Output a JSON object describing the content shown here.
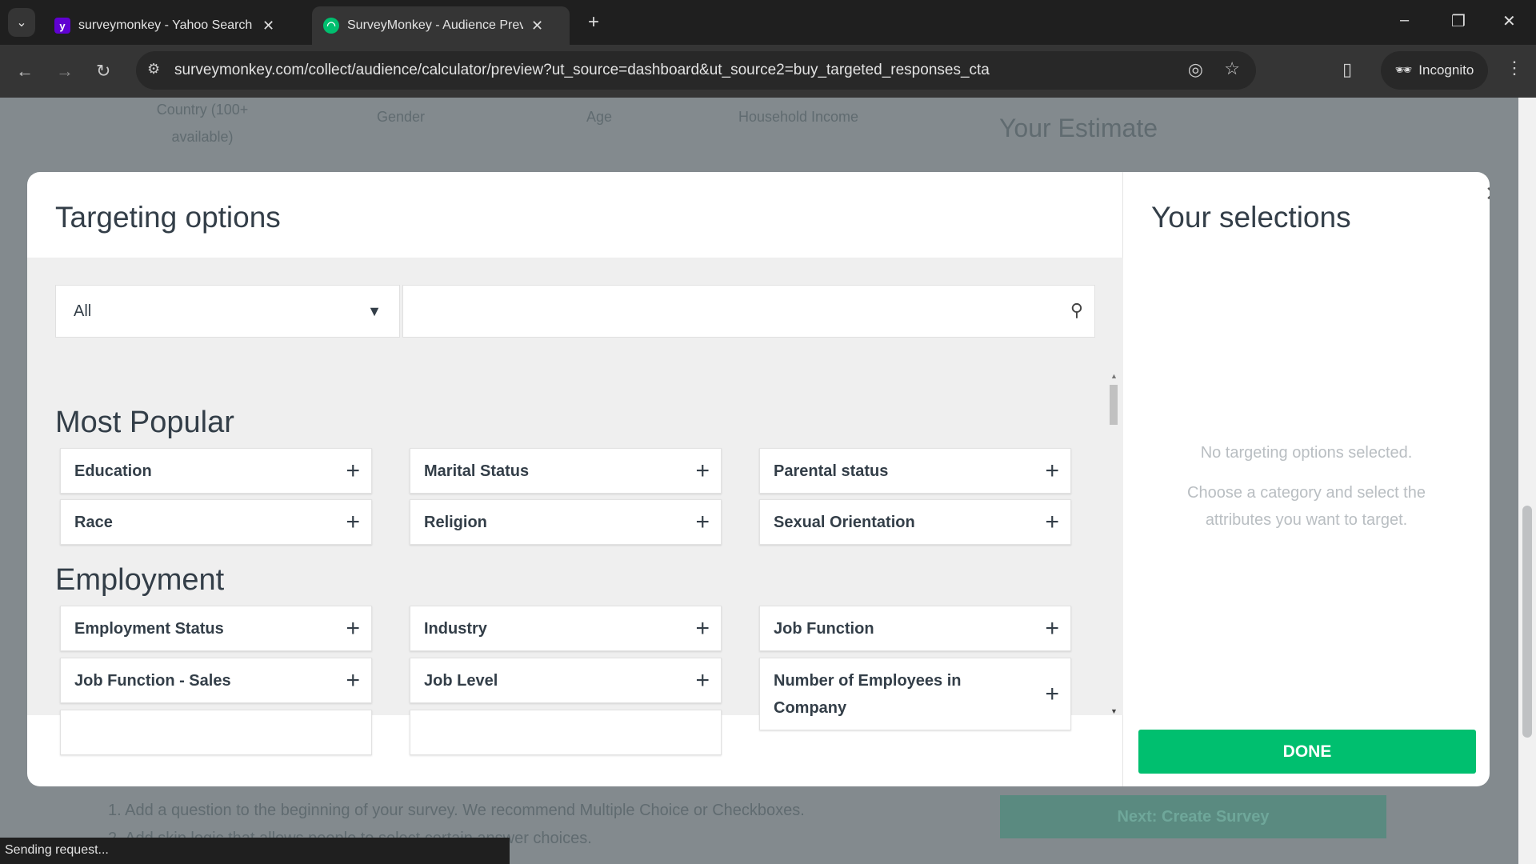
{
  "browser": {
    "tabs": [
      {
        "title": "surveymonkey - Yahoo Search R",
        "active": false
      },
      {
        "title": "SurveyMonkey - Audience Prev",
        "active": true
      }
    ],
    "url": "surveymonkey.com/collect/audience/calculator/preview?ut_source=dashboard&ut_source2=buy_targeted_responses_cta",
    "incognito_label": "Incognito",
    "status": "Sending request..."
  },
  "background": {
    "country": "Country (100+ available)",
    "gender": "Gender",
    "age": "Age",
    "income": "Household Income",
    "estimate": "Your Estimate",
    "step1": "1. Add a question to the beginning of your survey. We recommend Multiple Choice or Checkboxes.",
    "step2": "2. Add skip logic that allows people to select certain answer choices.",
    "next_button": "Next: Create Survey"
  },
  "modal": {
    "title": "Targeting options",
    "filter_value": "All",
    "search_placeholder": "",
    "sections": [
      {
        "heading": "Most Popular",
        "items": [
          "Education",
          "Marital Status",
          "Parental status",
          "Race",
          "Religion",
          "Sexual Orientation"
        ]
      },
      {
        "heading": "Employment",
        "items": [
          "Employment Status",
          "Industry",
          "Job Function",
          "Job Function - Sales",
          "Job Level",
          "Number of Employees in Company"
        ]
      }
    ],
    "selections_title": "Your selections",
    "empty_line1": "No targeting options selected.",
    "empty_line2": "Choose a category and select the attributes you want to target.",
    "done_label": "DONE"
  },
  "colors": {
    "accent": "#00bf6f"
  }
}
